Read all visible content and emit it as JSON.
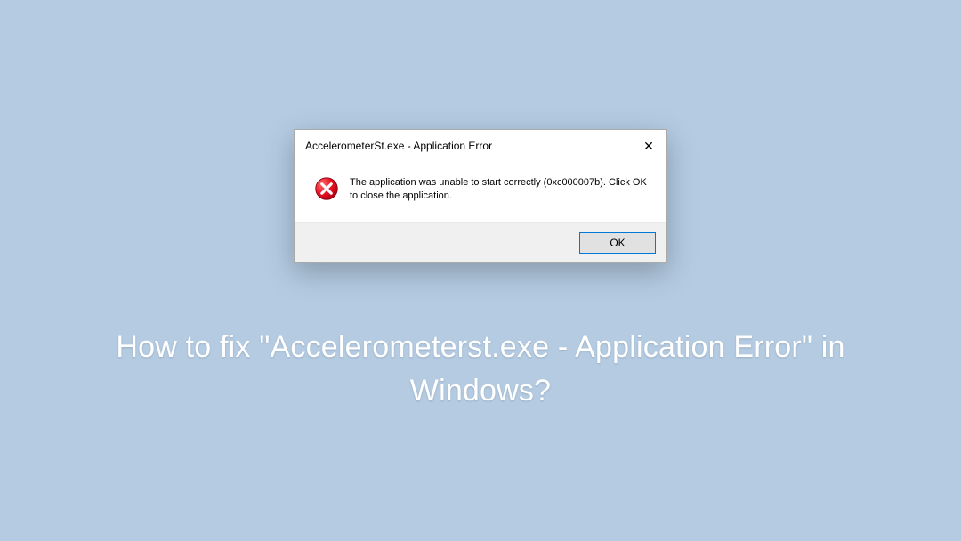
{
  "dialog": {
    "title": "AccelerometerSt.exe - Application Error",
    "message": "The application was unable to start correctly (0xc000007b). Click OK to close the application.",
    "ok_label": "OK",
    "close_glyph": "✕"
  },
  "headline": "How to fix \"Accelerometerst.exe - Application Error\" in Windows?"
}
